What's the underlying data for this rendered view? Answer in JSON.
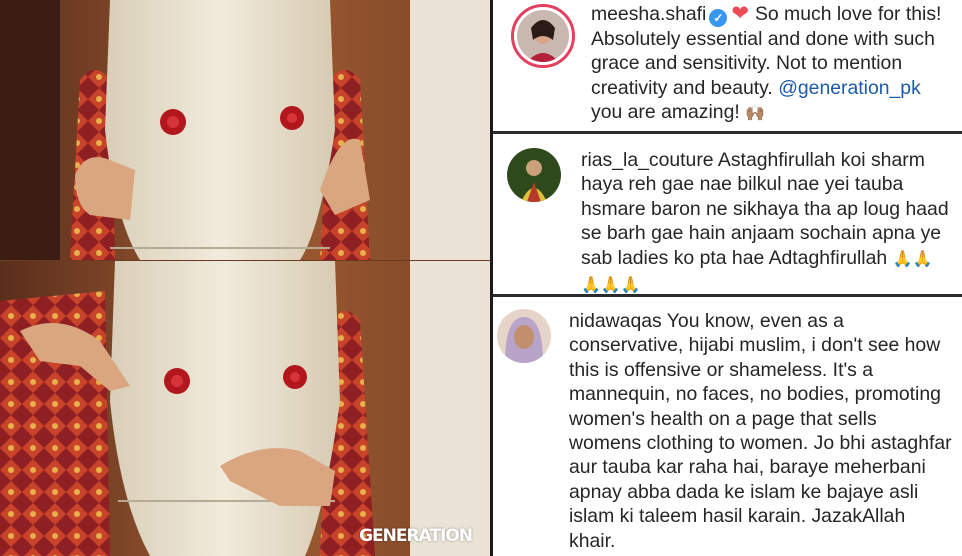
{
  "watermark": "GENERATION",
  "comments": [
    {
      "username": "meesha.shafi",
      "verified": true,
      "text_before": "So much love for this! Absolutely essential and done with such grace and sensitivity. Not to mention creativity and beauty.",
      "mention": "@generation_pk",
      "text_after": "you are amazing!",
      "emoji": "🙌🏽"
    },
    {
      "username": "rias_la_couture",
      "text": "Astaghfirullah koi sharm haya reh gae nae bilkul nae yei tauba hsmare baron ne sikhaya tha ap loug haad se barh gae hain anjaam sochain apna ye sab ladies ko pta hae Adtaghfirullah",
      "emoji": "🙏🙏🙏🙏🙏"
    },
    {
      "username": "nidawaqas",
      "text": "You know, even as a conservative, hijabi muslim, i don't see how this is offensive or shameless. It's a mannequin, no faces, no bodies, promoting women's health on a page that sells womens clothing to women. Jo bhi astaghfar aur tauba kar raha hai, baraye meherbani apnay abba dada ke islam ke bajaye asli islam ki taleem hasil karain. JazakAllah khair."
    }
  ],
  "colors": {
    "mention": "#1e5aa8",
    "verified": "#3897f0",
    "heart": "#ed4956",
    "story_ring": "#e4405f"
  }
}
